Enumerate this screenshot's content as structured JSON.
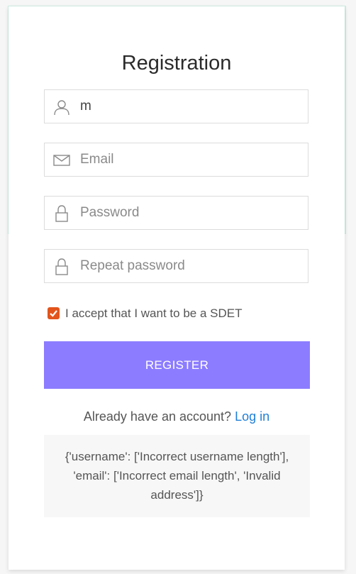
{
  "title": "Registration",
  "fields": {
    "username": {
      "value": "m",
      "placeholder": ""
    },
    "email": {
      "value": "",
      "placeholder": "Email"
    },
    "password": {
      "value": "",
      "placeholder": "Password"
    },
    "repeat_password": {
      "value": "",
      "placeholder": "Repeat password"
    }
  },
  "checkbox": {
    "label": "I accept that I want to be a SDET",
    "checked": true
  },
  "register_button": "REGISTER",
  "login_prompt": {
    "text": "Already have an account?",
    "link": "Log in"
  },
  "error_message": "{'username': ['Incorrect username length'], 'email': ['Incorrect email length', 'Invalid address']}",
  "colors": {
    "accent": "#8c7cff",
    "checkbox": "#e2541c",
    "link": "#1f7fd6"
  },
  "icons": {
    "username": "user-icon",
    "email": "envelope-icon",
    "password": "lock-icon",
    "repeat_password": "lock-icon"
  }
}
